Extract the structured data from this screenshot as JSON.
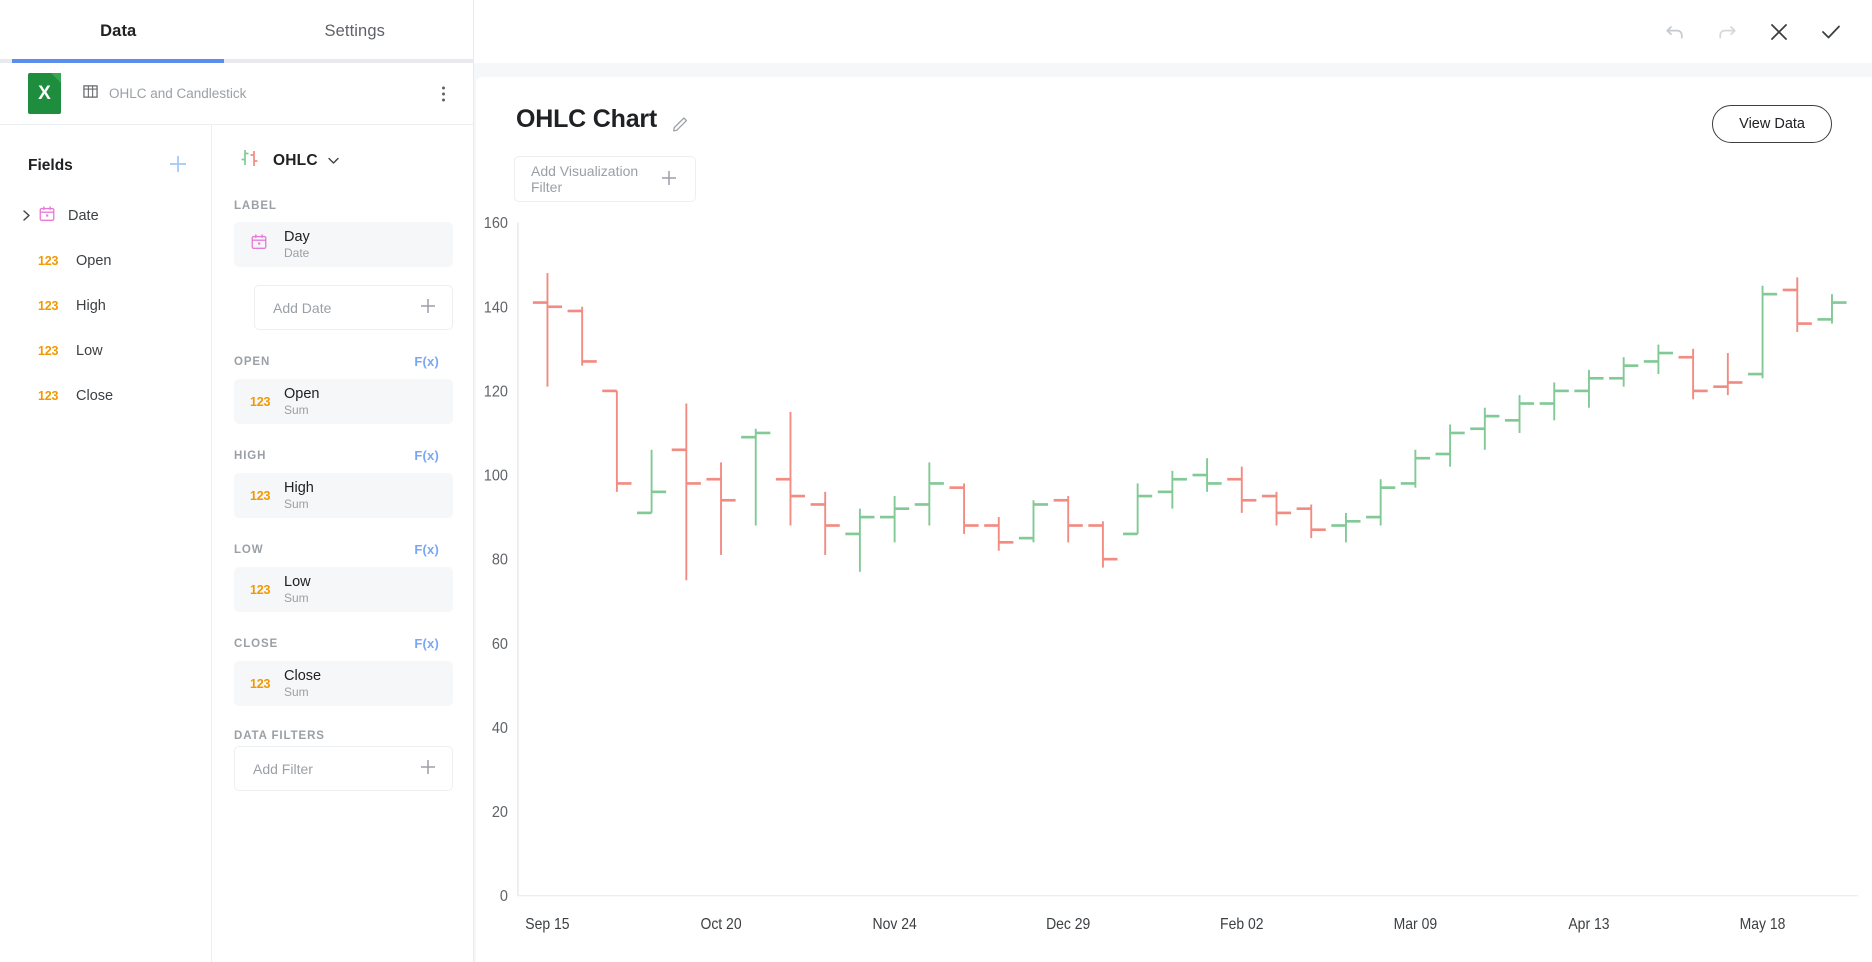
{
  "tabs": [
    {
      "label": "Data",
      "active": true
    },
    {
      "label": "Settings",
      "active": false
    }
  ],
  "datasource": {
    "label": "OHLC and Candlestick",
    "icon": "spreadsheet-icon",
    "table_icon": "table-icon"
  },
  "fields": {
    "title": "Fields",
    "add_label": "+",
    "items": [
      {
        "name": "Date",
        "type": "date",
        "type_badge": "",
        "expandable": true
      },
      {
        "name": "Open",
        "type": "number",
        "type_badge": "123",
        "expandable": false
      },
      {
        "name": "High",
        "type": "number",
        "type_badge": "123",
        "expandable": false
      },
      {
        "name": "Low",
        "type": "number",
        "type_badge": "123",
        "expandable": false
      },
      {
        "name": "Close",
        "type": "number",
        "type_badge": "123",
        "expandable": false
      }
    ]
  },
  "viz": {
    "type_label": "OHLC",
    "shelves": [
      {
        "label": "LABEL",
        "fx": "",
        "pill": {
          "title": "Day",
          "sub": "Date",
          "badge": "",
          "type": "date"
        },
        "add_placeholder": "Add Date"
      },
      {
        "label": "OPEN",
        "fx": "F(x)",
        "pill": {
          "title": "Open",
          "sub": "Sum",
          "badge": "123",
          "type": "number"
        }
      },
      {
        "label": "HIGH",
        "fx": "F(x)",
        "pill": {
          "title": "High",
          "sub": "Sum",
          "badge": "123",
          "type": "number"
        }
      },
      {
        "label": "LOW",
        "fx": "F(x)",
        "pill": {
          "title": "Low",
          "sub": "Sum",
          "badge": "123",
          "type": "number"
        }
      },
      {
        "label": "CLOSE",
        "fx": "F(x)",
        "pill": {
          "title": "Close",
          "sub": "Sum",
          "badge": "123",
          "type": "number"
        }
      },
      {
        "label": "DATA FILTERS",
        "fx": "",
        "pill": null,
        "add_placeholder": "Add Filter"
      }
    ]
  },
  "toolbar": {
    "undo": "undo-icon",
    "redo": "redo-icon",
    "close": "close-icon",
    "confirm": "check-icon"
  },
  "main": {
    "title": "OHLC Chart",
    "edit_title_icon": "pencil-icon",
    "view_data_label": "View Data",
    "filter_placeholder": "Add Visualization Filter"
  },
  "colors": {
    "accent": "#5b8def",
    "up": "#81c995",
    "down": "#f28b82",
    "text": "#202124",
    "muted": "#9aa0a6",
    "number_badge": "#f29900",
    "date_badge": "#e87ad9"
  },
  "chart_data": {
    "type": "ohlc",
    "title": "OHLC Chart",
    "xlabel": "",
    "ylabel": "",
    "ylim": [
      0,
      160
    ],
    "yticks": [
      0,
      20,
      40,
      60,
      80,
      100,
      120,
      140,
      160
    ],
    "grid": false,
    "legend": "none",
    "xticks": [
      "Sep 15",
      "Oct 20",
      "Nov 24",
      "Dec 29",
      "Feb 02",
      "Mar 09",
      "Apr 13",
      "May 18"
    ],
    "xtick_indices": [
      0,
      5,
      10,
      15,
      20,
      25,
      30,
      35
    ],
    "series_name": "Day",
    "points": [
      {
        "x": "Sep 15",
        "open": 141,
        "high": 148,
        "low": 121,
        "close": 140,
        "dir": "down"
      },
      {
        "x": "Sep 22",
        "open": 139,
        "high": 140,
        "low": 126,
        "close": 127,
        "dir": "down"
      },
      {
        "x": "Sep 29",
        "open": 120,
        "high": 120,
        "low": 96,
        "close": 98,
        "dir": "down"
      },
      {
        "x": "Oct 06",
        "open": 91,
        "high": 106,
        "low": 91,
        "close": 96,
        "dir": "up"
      },
      {
        "x": "Oct 13",
        "open": 106,
        "high": 117,
        "low": 75,
        "close": 98,
        "dir": "down"
      },
      {
        "x": "Oct 20",
        "open": 99,
        "high": 103,
        "low": 81,
        "close": 94,
        "dir": "down"
      },
      {
        "x": "Oct 27",
        "open": 109,
        "high": 111,
        "low": 88,
        "close": 110,
        "dir": "up"
      },
      {
        "x": "Nov 03",
        "open": 99,
        "high": 115,
        "low": 88,
        "close": 95,
        "dir": "down"
      },
      {
        "x": "Nov 10",
        "open": 93,
        "high": 96,
        "low": 81,
        "close": 88,
        "dir": "down"
      },
      {
        "x": "Nov 17",
        "open": 86,
        "high": 92,
        "low": 77,
        "close": 90,
        "dir": "up"
      },
      {
        "x": "Nov 24",
        "open": 90,
        "high": 95,
        "low": 84,
        "close": 92,
        "dir": "up"
      },
      {
        "x": "Dec 01",
        "open": 93,
        "high": 103,
        "low": 88,
        "close": 98,
        "dir": "up"
      },
      {
        "x": "Dec 08",
        "open": 97,
        "high": 98,
        "low": 86,
        "close": 88,
        "dir": "down"
      },
      {
        "x": "Dec 15",
        "open": 88,
        "high": 90,
        "low": 82,
        "close": 84,
        "dir": "down"
      },
      {
        "x": "Dec 22",
        "open": 85,
        "high": 94,
        "low": 84,
        "close": 93,
        "dir": "up"
      },
      {
        "x": "Dec 29",
        "open": 94,
        "high": 95,
        "low": 84,
        "close": 88,
        "dir": "down"
      },
      {
        "x": "Jan 05",
        "open": 88,
        "high": 89,
        "low": 78,
        "close": 80,
        "dir": "down"
      },
      {
        "x": "Jan 12",
        "open": 86,
        "high": 98,
        "low": 86,
        "close": 95,
        "dir": "up"
      },
      {
        "x": "Jan 19",
        "open": 96,
        "high": 101,
        "low": 92,
        "close": 99,
        "dir": "up"
      },
      {
        "x": "Jan 26",
        "open": 100,
        "high": 104,
        "low": 96,
        "close": 98,
        "dir": "up"
      },
      {
        "x": "Feb 02",
        "open": 99,
        "high": 102,
        "low": 91,
        "close": 94,
        "dir": "down"
      },
      {
        "x": "Feb 09",
        "open": 95,
        "high": 96,
        "low": 88,
        "close": 91,
        "dir": "down"
      },
      {
        "x": "Feb 16",
        "open": 92,
        "high": 93,
        "low": 85,
        "close": 87,
        "dir": "down"
      },
      {
        "x": "Feb 23",
        "open": 88,
        "high": 91,
        "low": 84,
        "close": 89,
        "dir": "up"
      },
      {
        "x": "Mar 02",
        "open": 90,
        "high": 99,
        "low": 88,
        "close": 97,
        "dir": "up"
      },
      {
        "x": "Mar 09",
        "open": 98,
        "high": 106,
        "low": 97,
        "close": 104,
        "dir": "up"
      },
      {
        "x": "Mar 16",
        "open": 105,
        "high": 112,
        "low": 102,
        "close": 110,
        "dir": "up"
      },
      {
        "x": "Mar 23",
        "open": 111,
        "high": 116,
        "low": 106,
        "close": 114,
        "dir": "up"
      },
      {
        "x": "Mar 30",
        "open": 113,
        "high": 119,
        "low": 110,
        "close": 117,
        "dir": "up"
      },
      {
        "x": "Apr 06",
        "open": 117,
        "high": 122,
        "low": 113,
        "close": 120,
        "dir": "up"
      },
      {
        "x": "Apr 13",
        "open": 120,
        "high": 125,
        "low": 116,
        "close": 123,
        "dir": "up"
      },
      {
        "x": "Apr 20",
        "open": 123,
        "high": 128,
        "low": 121,
        "close": 126,
        "dir": "up"
      },
      {
        "x": "Apr 27",
        "open": 127,
        "high": 131,
        "low": 124,
        "close": 129,
        "dir": "up"
      },
      {
        "x": "May 04",
        "open": 128,
        "high": 130,
        "low": 118,
        "close": 120,
        "dir": "down"
      },
      {
        "x": "May 11",
        "open": 121,
        "high": 129,
        "low": 119,
        "close": 122,
        "dir": "down"
      },
      {
        "x": "May 18",
        "open": 124,
        "high": 145,
        "low": 123,
        "close": 143,
        "dir": "up"
      },
      {
        "x": "May 25",
        "open": 144,
        "high": 147,
        "low": 134,
        "close": 136,
        "dir": "down"
      },
      {
        "x": "Jun 01",
        "open": 137,
        "high": 143,
        "low": 136,
        "close": 141,
        "dir": "up"
      }
    ]
  }
}
